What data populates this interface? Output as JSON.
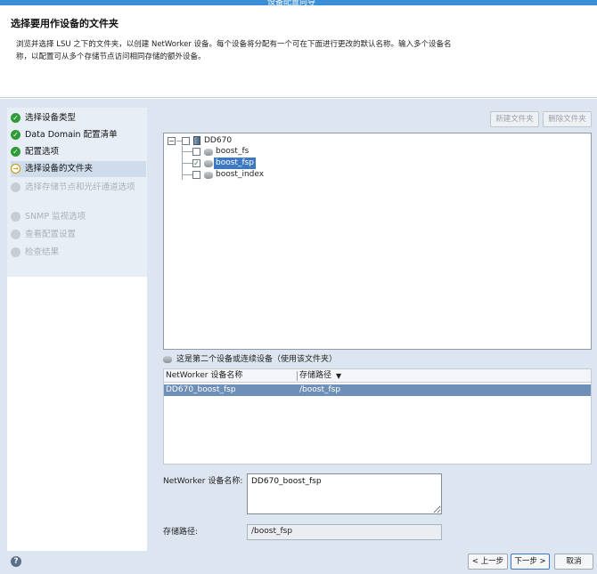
{
  "window": {
    "title": "设备配置向导"
  },
  "header": {
    "title": "选择要用作设备的文件夹",
    "description": "浏览并选择 LSU 之下的文件夹，以创建 NetWorker 设备。每个设备将分配有一个可在下面进行更改的默认名称。输入多个设备名称，以配置可从多个存储节点访问相同存储的额外设备。"
  },
  "nav": {
    "items": [
      {
        "label": "选择设备类型",
        "state": "done"
      },
      {
        "label": "Data Domain 配置清单",
        "state": "done"
      },
      {
        "label": "配置选项",
        "state": "done"
      },
      {
        "label": "选择设备的文件夹",
        "state": "current"
      },
      {
        "label": "选择存储节点和光纤通道选项",
        "state": "todo"
      },
      {
        "label": "SNMP 监视选项",
        "state": "todo"
      },
      {
        "label": "查看配置设置",
        "state": "todo"
      },
      {
        "label": "检查结果",
        "state": "todo"
      }
    ]
  },
  "toolbar": {
    "new_folder": "新建文件夹",
    "delete_folder": "删除文件夹"
  },
  "tree": {
    "root": {
      "label": "DD670",
      "expander": "−"
    },
    "children": [
      {
        "label": "boost_fs",
        "checked": false
      },
      {
        "label": "boost_fsp",
        "checked": true
      },
      {
        "label": "boost_index",
        "checked": false
      }
    ]
  },
  "device_note": "这是第二个设备或连续设备（使用该文件夹）",
  "grid": {
    "columns": [
      "NetWorker 设备名称",
      "存储路径"
    ],
    "sort_indicator": "▼",
    "rows": [
      {
        "name": "DD670_boost_fsp",
        "path": "/boost_fsp"
      }
    ]
  },
  "form": {
    "device_name_label": "NetWorker 设备名称:",
    "device_name_value": "DD670_boost_fsp",
    "storage_path_label": "存储路径:",
    "storage_path_value": "/boost_fsp"
  },
  "footer": {
    "back": "< 上一步",
    "next": "下一步 >",
    "cancel": "取消",
    "help": "?"
  },
  "icons": {
    "done": "check-circle-icon",
    "current": "arrow-circle-icon",
    "todo": "pending-circle-icon",
    "help": "help-icon",
    "device": "disk-icon",
    "root": "server-icon"
  },
  "colors": {
    "done": "#2e9b37",
    "current": "#c89400",
    "selection": "#3d79c2",
    "row_selected": "#6e8fb8"
  }
}
